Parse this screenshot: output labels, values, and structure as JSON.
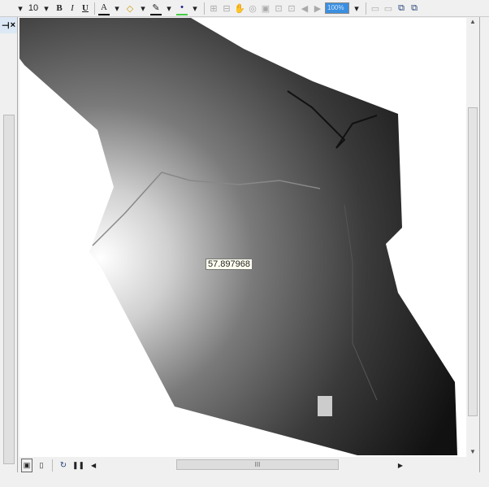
{
  "toolbar": {
    "font_size": "10",
    "bold": "B",
    "italic": "I",
    "underline": "U",
    "font_color": "A",
    "zoom_value": "100%"
  },
  "left_panel": {
    "pin": "⊣",
    "close": "×"
  },
  "map": {
    "identify_value": "57.897968"
  },
  "scroll": {
    "grip": "III"
  }
}
